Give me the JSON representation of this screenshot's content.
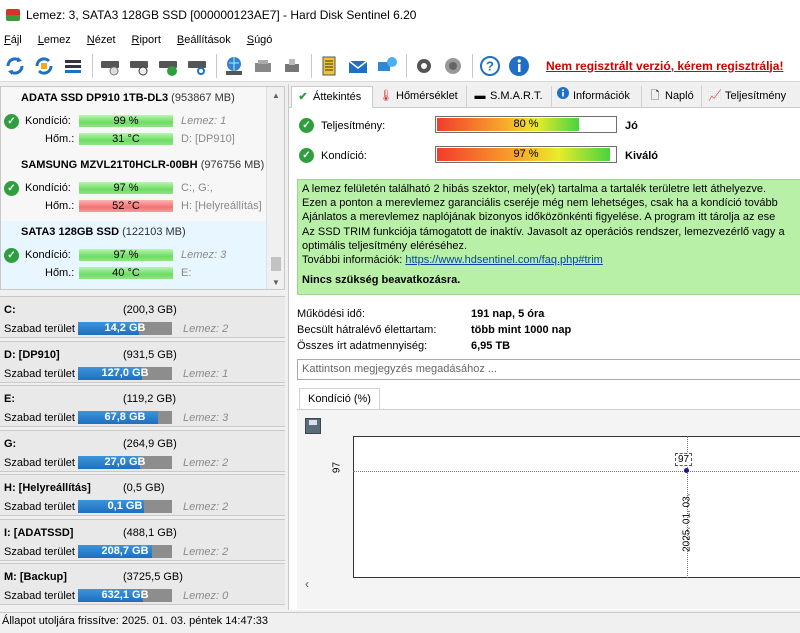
{
  "window": {
    "title": "Lemez: 3, SATA3 128GB SSD [000000123AE7]  -  Hard Disk Sentinel 6.20"
  },
  "menu": [
    "Fájl",
    "Lemez",
    "Nézet",
    "Riport",
    "Beállítások",
    "Súgó"
  ],
  "toolbar": {
    "icons": [
      "refresh-icon",
      "refresh-all-icon",
      "disk-list-icon",
      "disk-test-icon",
      "disk-schedule-icon",
      "disk-ok-icon",
      "disk-search-icon",
      "network-icon",
      "tools-icon",
      "usb-icon",
      "report-icon",
      "mail-icon",
      "send-icon",
      "settings-icon",
      "speaker-icon",
      "help-icon",
      "info-icon"
    ],
    "register_link": "Nem regisztrált verzió, kérem regisztrálja!"
  },
  "disks": [
    {
      "name": "ADATA SSD DP910 1TB-DL3",
      "size": "(953867 MB)",
      "kondicio_label": "Kondíció:",
      "kondicio": "99 %",
      "kondicio_percent": 99,
      "hom_label": "Hőm.:",
      "hom": "31 °C",
      "disk_ref": "Lemez: 1",
      "partitions": "D: [DP910]",
      "hot": false
    },
    {
      "name": "SAMSUNG MZVL21T0HCLR-00BH",
      "size": "(976756 MB)",
      "kondicio_label": "Kondíció:",
      "kondicio": "97 %",
      "kondicio_percent": 97,
      "hom_label": "Hőm.:",
      "hom": "52 °C",
      "disk_ref": "C:, G:,",
      "partitions": "H: [Helyreállítás]",
      "hot": true
    },
    {
      "name": "SATA3 128GB SSD",
      "size": "(122103 MB)",
      "kondicio_label": "Kondíció:",
      "kondicio": "97 %",
      "kondicio_percent": 97,
      "hom_label": "Hőm.:",
      "hom": "40 °C",
      "disk_ref": "Lemez: 3",
      "partitions": "E:",
      "hot": false
    }
  ],
  "partitions": [
    {
      "name": "C:",
      "size": "(200,3 GB)",
      "free_label": "Szabad terület",
      "free": "14,2 GB",
      "free_fraction": 0.07,
      "disk": "Lemez: 2"
    },
    {
      "name": "D: [DP910]",
      "size": "(931,5 GB)",
      "free_label": "Szabad terület",
      "free": "127,0 GB",
      "free_fraction": 0.14,
      "disk": "Lemez: 1"
    },
    {
      "name": "E:",
      "size": "(119,2 GB)",
      "free_label": "Szabad terület",
      "free": "67,8 GB",
      "free_fraction": 0.57,
      "disk": "Lemez: 3"
    },
    {
      "name": "G:",
      "size": "(264,9 GB)",
      "free_label": "Szabad terület",
      "free": "27,0 GB",
      "free_fraction": 0.1,
      "disk": "Lemez: 2"
    },
    {
      "name": "H: [Helyreállítás]",
      "size": "(0,5 GB)",
      "free_label": "Szabad terület",
      "free": "0,1 GB",
      "free_fraction": 0.2,
      "disk": "Lemez: 2"
    },
    {
      "name": "I: [ADATSSD]",
      "size": "(488,1 GB)",
      "free_label": "Szabad terület",
      "free": "208,7 GB",
      "free_fraction": 0.43,
      "disk": "Lemez: 2"
    },
    {
      "name": "M: [Backup]",
      "size": "(3725,5 GB)",
      "free_label": "Szabad terület",
      "free": "632,1 GB",
      "free_fraction": 0.17,
      "disk": "Lemez: 0"
    }
  ],
  "tabs": [
    {
      "label": "Áttekintés",
      "icon": "check-icon"
    },
    {
      "label": "Hőmérséklet",
      "icon": "thermometer-icon"
    },
    {
      "label": "S.M.A.R.T.",
      "icon": "smart-icon"
    },
    {
      "label": "Információk",
      "icon": "info-icon"
    },
    {
      "label": "Napló",
      "icon": "log-icon"
    },
    {
      "label": "Teljesítmény",
      "icon": "performance-icon"
    }
  ],
  "overview": {
    "performance_label": "Teljesítmény:",
    "performance": "80 %",
    "performance_percent": 80,
    "performance_word": "Jó",
    "health_label": "Kondíció:",
    "health": "97 %",
    "health_percent": 97,
    "health_word": "Kiváló",
    "info_lines": [
      "A lemez felületén található 2 hibás szektor, mely(ek) tartalma a tartalék területre lett áthelyezve.",
      "Ezen a ponton a merevlemez garanciális cseréje még nem lehetséges, csak ha a kondíció tovább",
      "Ajánlatos a merevlemez naplójának bizonyos időközönkénti figyelése. A program itt tárolja az ese",
      "Az SSD TRIM funkciója támogatott de inaktív. Javasolt az operációs rendszer, lemezvezérlő vagy a",
      "optimális teljesítmény eléréséhez."
    ],
    "more_info_label": "További információk:",
    "more_info_link": "https://www.hdsentinel.com/faq.php#trim",
    "action": "Nincs szükség beavatkozásra.",
    "uptime_label": "Működési idő:",
    "uptime": "191 nap, 5 óra",
    "remaining_label": "Becsült hátralévő élettartam:",
    "remaining": "több mint 1000 nap",
    "written_label": "Összes írt adatmennyiség:",
    "written": "6,95 TB",
    "comment_placeholder": "Kattintson megjegyzés megadásához ..."
  },
  "chart_tab_label": "Kondíció  (%)",
  "chart_data": {
    "type": "line",
    "x": [
      "2025. 01. 03."
    ],
    "series": [
      {
        "values": [
          97
        ]
      }
    ],
    "y_tick": "97",
    "grid": false
  },
  "status": {
    "text": "Állapot utoljára frissítve: 2025. 01. 03. péntek 14:47:33"
  }
}
